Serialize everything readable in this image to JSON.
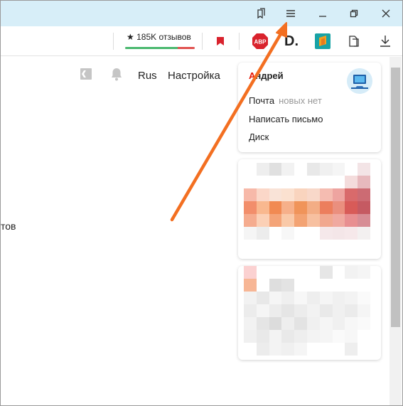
{
  "toolbar": {
    "reviews_star": "★",
    "reviews_text": "185K отзывов",
    "ext_abp_label": "ABP",
    "ext_d_label": "D."
  },
  "nav": {
    "language": "Rus",
    "settings": "Настройка"
  },
  "page": {
    "partial_text": "тов"
  },
  "account": {
    "name_first_letter": "А",
    "name_rest": "ндрей",
    "mail_label": "Почта",
    "mail_status": "новых нет",
    "compose_label": "Написать письмо",
    "disk_label": "Диск"
  },
  "colors": {
    "titlebar_bg": "#d7eef8",
    "annotation_arrow": "#f36f21",
    "name_accent": "#e61400"
  },
  "icons": {
    "titlebar": [
      "bookmarks-icon",
      "menu-icon",
      "minimize-icon",
      "restore-icon",
      "close-icon"
    ],
    "toolbar": [
      "bookmark-flag-icon",
      "adblock-plus-icon",
      "d-extension-icon",
      "orange-extension-icon",
      "collections-icon",
      "download-icon"
    ],
    "page": [
      "collections-nav-icon",
      "bell-icon"
    ]
  }
}
